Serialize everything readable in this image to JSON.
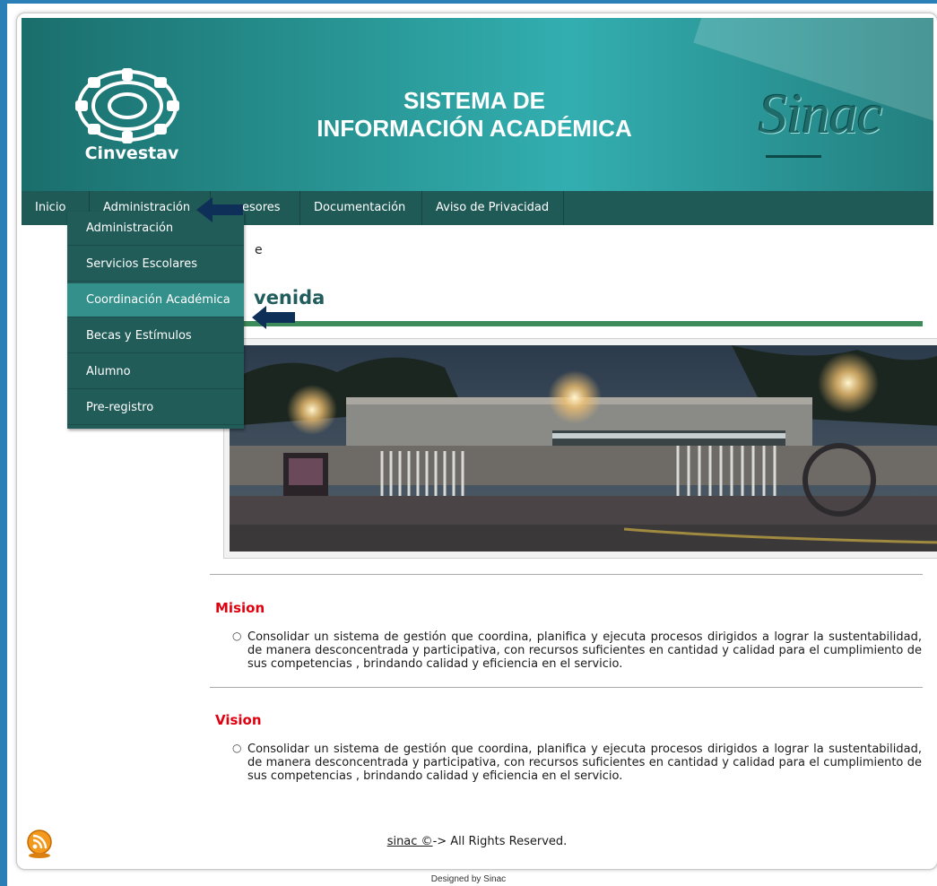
{
  "header": {
    "logo_text": "Cinvestav",
    "title_line1": "SISTEMA DE",
    "title_line2": "INFORMACIÓN ACADÉMICA",
    "brand_logo": "Sinac"
  },
  "nav": {
    "items": [
      {
        "label": "Inicio"
      },
      {
        "label": "Administración"
      },
      {
        "label": "esores"
      },
      {
        "label": "Documentación"
      },
      {
        "label": "Aviso de Privacidad"
      }
    ]
  },
  "dropdown": {
    "items": [
      {
        "label": "Administración"
      },
      {
        "label": "Servicios Escolares"
      },
      {
        "label": "Coordinación Académica"
      },
      {
        "label": "Becas y Estímulos"
      },
      {
        "label": "Alumno"
      },
      {
        "label": "Pre-registro"
      }
    ],
    "active_index": 2
  },
  "main": {
    "breadcrumb": "e",
    "welcome": "venida"
  },
  "mission": {
    "title": "Mision",
    "text": "Consolidar un sistema de gestión que coordina, planifica y ejecuta procesos dirigidos a lograr la sustentabilidad, de manera desconcentrada y participativa, con recursos suficientes en cantidad y calidad para el cumplimiento de sus competencias , brindando calidad y eficiencia en el servicio."
  },
  "vision": {
    "title": "Vision",
    "text": "Consolidar un sistema de gestión que coordina, planifica y ejecuta procesos dirigidos a lograr la sustentabilidad, de manera desconcentrada y participativa, con recursos suficientes en cantidad y calidad para el cumplimiento de sus competencias , brindando calidad y eficiencia en el servicio."
  },
  "footer": {
    "link_text": "sinac ©",
    "rights_text": "-> All Rights Reserved.",
    "designed_by": "Designed by Sinac"
  },
  "colors": {
    "accent": "#215c58",
    "active_menu": "#33908a",
    "section_title": "#e0000f",
    "rule": "#3d8a5a",
    "arrow": "#0e2f57"
  }
}
